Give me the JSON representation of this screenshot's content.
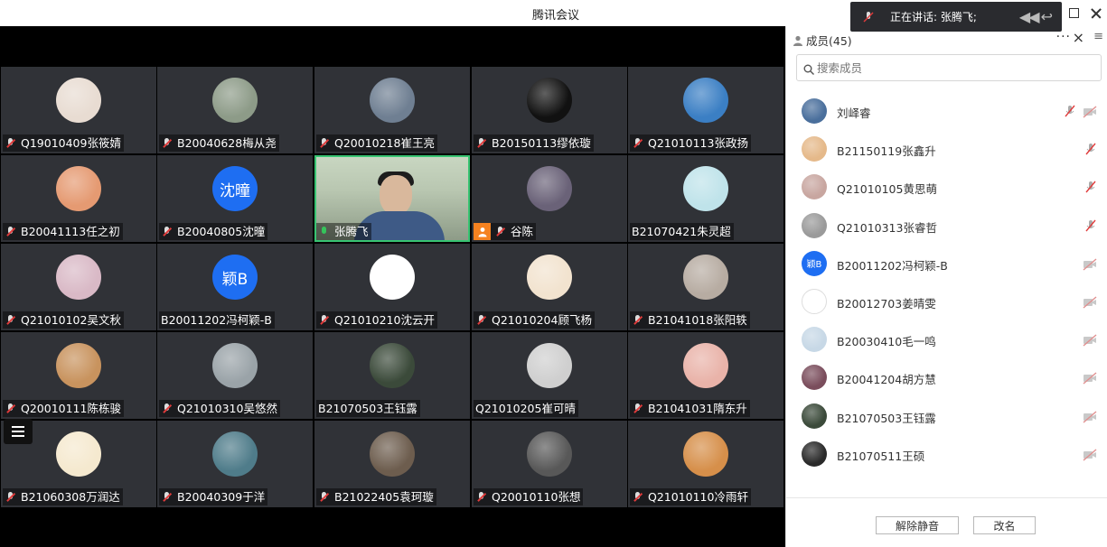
{
  "window": {
    "title": "腾讯会议"
  },
  "speaking_toast": {
    "label": "正在讲话: 张腾飞;"
  },
  "tiles": [
    {
      "name": "Q19010409张筱婧",
      "avatar": "photo",
      "color": "#e8dcd2"
    },
    {
      "name": "B20040628梅从尧",
      "avatar": "photo",
      "color": "#8d9b88"
    },
    {
      "name": "Q20010218崔王亮",
      "avatar": "photo",
      "color": "#6f7f92"
    },
    {
      "name": "B20150113缪依璇",
      "avatar": "photo",
      "color": "#111111"
    },
    {
      "name": "Q21010113张政扬",
      "avatar": "photo",
      "color": "#3b7fc4"
    },
    {
      "name": "B20041113任之初",
      "avatar": "photo",
      "color": "#e59a72"
    },
    {
      "name": "B20040805沈曈",
      "avatar": "text",
      "text": "沈曈"
    },
    {
      "name": "张腾飞",
      "avatar": "video",
      "active": true
    },
    {
      "name": "谷陈",
      "avatar": "photo",
      "color": "#6a6278",
      "badge": true
    },
    {
      "name": "B21070421朱灵超",
      "avatar": "photo",
      "color": "#bfe3ea",
      "nomic": true
    },
    {
      "name": "Q21010102吴文秋",
      "avatar": "photo",
      "color": "#d9b9c6"
    },
    {
      "name": "B20011202冯柯颖-B",
      "avatar": "text",
      "text": "颖B",
      "nomic": true
    },
    {
      "name": "Q21010210沈云开",
      "avatar": "photo",
      "color": "#ffffff"
    },
    {
      "name": "Q21010204顾飞杨",
      "avatar": "photo",
      "color": "#f2e3cf"
    },
    {
      "name": "B21041018张阳轶",
      "avatar": "photo",
      "color": "#b7aca2"
    },
    {
      "name": "Q20010111陈栋骏",
      "avatar": "photo",
      "color": "#c8935e"
    },
    {
      "name": "Q21010310吴悠然",
      "avatar": "photo",
      "color": "#9aa3a8"
    },
    {
      "name": "B21070503王钰露",
      "avatar": "photo",
      "color": "#3b4a3a",
      "nomic": true
    },
    {
      "name": "Q21010205崔可晴",
      "avatar": "photo",
      "color": "#cfcfcf",
      "nomic": true
    },
    {
      "name": "B21041031隋东升",
      "avatar": "photo",
      "color": "#e9b3a9"
    },
    {
      "name": "B21060308万润达",
      "avatar": "photo",
      "color": "#f5e9cf"
    },
    {
      "name": "B20040309于洋",
      "avatar": "photo",
      "color": "#4f7c8a"
    },
    {
      "name": "B21022405袁珂璇",
      "avatar": "photo",
      "color": "#6d5d4e"
    },
    {
      "name": "Q20010110张想",
      "avatar": "photo",
      "color": "#585858"
    },
    {
      "name": "Q21010110冷雨轩",
      "avatar": "photo",
      "color": "#d68f4a"
    }
  ],
  "panel": {
    "title": "成员(45)",
    "more": "···",
    "close": "×",
    "search_placeholder": "搜索成员",
    "members": [
      {
        "name": "刘峄睿",
        "color": "#4a6f9c",
        "mic": "off",
        "cam": "off"
      },
      {
        "name": "B21150119张鑫升",
        "color": "#e5b98a",
        "mic": "off",
        "cam": "none"
      },
      {
        "name": "Q21010105黄思萌",
        "color": "#c8a6a0",
        "mic": "off",
        "cam": "none"
      },
      {
        "name": "Q21010313张睿哲",
        "color": "#9a9a9a",
        "mic": "off",
        "cam": "none"
      },
      {
        "name": "B20011202冯柯颖-B",
        "text": "颖B",
        "mic": "none",
        "cam": "off"
      },
      {
        "name": "B20012703姜晴雯",
        "color": "#ffffff",
        "mic": "none",
        "cam": "off"
      },
      {
        "name": "B20030410毛一鸣",
        "color": "#c7d8e6",
        "mic": "none",
        "cam": "off"
      },
      {
        "name": "B20041204胡方慧",
        "color": "#7a4d5c",
        "mic": "none",
        "cam": "off"
      },
      {
        "name": "B21070503王钰露",
        "color": "#3b4a3a",
        "mic": "none",
        "cam": "off"
      },
      {
        "name": "B21070511王硕",
        "color": "#2a2a2a",
        "mic": "none",
        "cam": "off"
      }
    ],
    "unmute_label": "解除静音",
    "rename_label": "改名"
  }
}
